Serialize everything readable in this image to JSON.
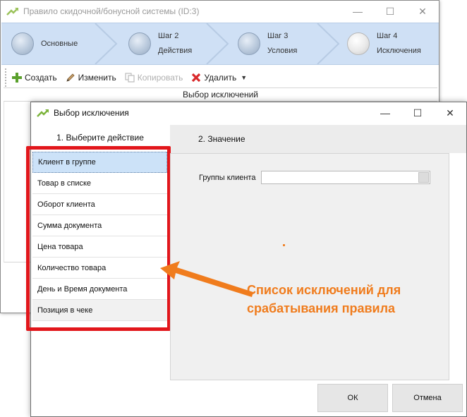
{
  "back_window": {
    "title": "Правило скидочной/бонусной системы (ID:3)",
    "steps": [
      {
        "line1": "Основные",
        "line2": ""
      },
      {
        "line1": "Шаг 2",
        "line2": "Действия"
      },
      {
        "line1": "Шаг 3",
        "line2": "Условия"
      },
      {
        "line1": "Шаг 4",
        "line2": "Исключения"
      }
    ],
    "toolbar": {
      "create": "Создать",
      "edit": "Изменить",
      "copy": "Копировать",
      "delete": "Удалить"
    },
    "grid_header": "Выбор  исключений"
  },
  "dialog": {
    "title": "Выбор исключения",
    "left_header": "1. Выберите  действие",
    "right_header": "2. Значение",
    "items": [
      "Клиент в группе",
      "Товар в списке",
      "Оборот клиента",
      "Сумма документа",
      "Цена товара",
      "Количество товара",
      "День и Время документа",
      "Позиция в чеке"
    ],
    "field_label": "Группы клиента",
    "field_value": "",
    "ok": "ОК",
    "cancel": "Отмена"
  },
  "callout": {
    "line1": "Список исключений для",
    "line2": "срабатывания правила"
  },
  "colors": {
    "accent_orange": "#f07c1d",
    "highlight_red": "#e2161b",
    "step_bar": "#cfe0f5",
    "selected_item": "#cce2f8"
  }
}
